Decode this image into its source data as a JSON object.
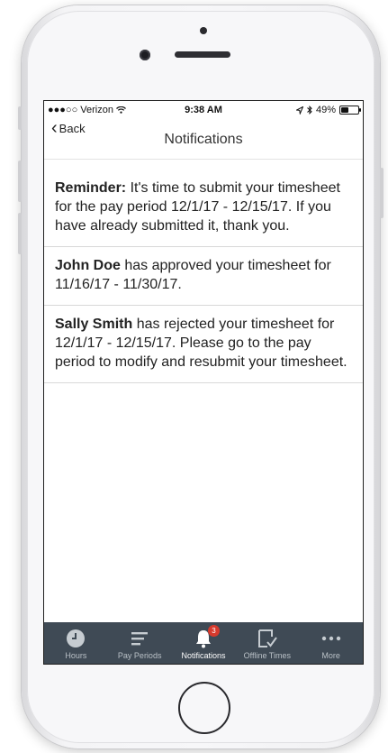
{
  "status_bar": {
    "carrier": "●●●○○ Verizon",
    "time": "9:38 AM",
    "battery": "49%",
    "battery_level": 0.49
  },
  "nav": {
    "back_label": "Back",
    "title": "Notifications"
  },
  "notifications": [
    {
      "bold": "Reminder:",
      "text": " It's time to submit your timesheet for the pay period 12/1/17 - 12/15/17. If you have already submitted it, thank you."
    },
    {
      "bold": "John Doe",
      "text": " has approved your timesheet for 11/16/17 - 11/30/17."
    },
    {
      "bold": "Sally Smith",
      "text": " has rejected your timesheet for 12/1/17 - 12/15/17. Please go to the pay period to modify and resubmit your timesheet."
    }
  ],
  "tabs": [
    {
      "label": "Hours",
      "icon": "clock-icon"
    },
    {
      "label": "Pay Periods",
      "icon": "list-icon"
    },
    {
      "label": "Notifications",
      "icon": "bell-icon",
      "badge": "3",
      "active": true
    },
    {
      "label": "Offline Times",
      "icon": "offline-checkbox-icon"
    },
    {
      "label": "More",
      "icon": "more-dots-icon"
    }
  ],
  "colors": {
    "tabbar_bg": "#3f4a55",
    "badge": "#d73a2d",
    "tab_inactive": "#b9c0c6",
    "tab_active": "#ffffff"
  }
}
